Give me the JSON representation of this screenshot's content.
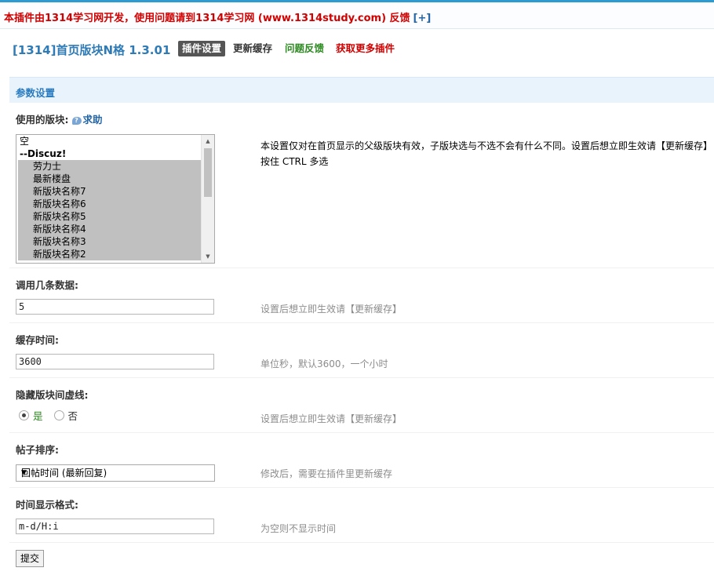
{
  "notice": {
    "text": "本插件由1314学习网开发，使用问题请到1314学习网 (www.1314study.com) 反馈",
    "toggle": "[+]"
  },
  "header": {
    "title": "[1314]首页版块N格 1.3.01",
    "tabs": {
      "settings": "插件设置",
      "cache": "更新缓存",
      "feedback": "问题反馈",
      "more": "获取更多插件"
    }
  },
  "section": {
    "title": "参数设置"
  },
  "fields": {
    "forums": {
      "label": "使用的版块:",
      "help": "求助",
      "help_glyph": "?",
      "options": [
        {
          "text": "空"
        },
        {
          "text": "--Discuz!"
        },
        {
          "text": "劳力士"
        },
        {
          "text": "最新楼盘"
        },
        {
          "text": "新版块名称7"
        },
        {
          "text": "新版块名称6"
        },
        {
          "text": "新版块名称5"
        },
        {
          "text": "新版块名称4"
        },
        {
          "text": "新版块名称3"
        },
        {
          "text": "新版块名称2"
        }
      ],
      "description": "本设置仅对在首页显示的父级版块有效，子版块选与不选不会有什么不同。设置后想立即生效请【更新缓存】 按住 CTRL 多选"
    },
    "count": {
      "label": "调用几条数据:",
      "value": "5",
      "hint": "设置后想立即生效请【更新缓存】"
    },
    "cache_time": {
      "label": "缓存时间:",
      "value": "3600",
      "hint": "单位秒，默认3600，一个小时"
    },
    "hide_lines": {
      "label": "隐藏版块间虚线:",
      "yes": "是",
      "no": "否",
      "hint": "设置后想立即生效请【更新缓存】"
    },
    "sort": {
      "label": "帖子排序:",
      "selected": "回帖时间 (最新回复)",
      "hint": "修改后，需要在插件里更新缓存"
    },
    "time_format": {
      "label": "时间显示格式:",
      "value": "m-d/H:i",
      "hint": "为空则不显示时间"
    }
  },
  "submit": {
    "label": "提交"
  }
}
